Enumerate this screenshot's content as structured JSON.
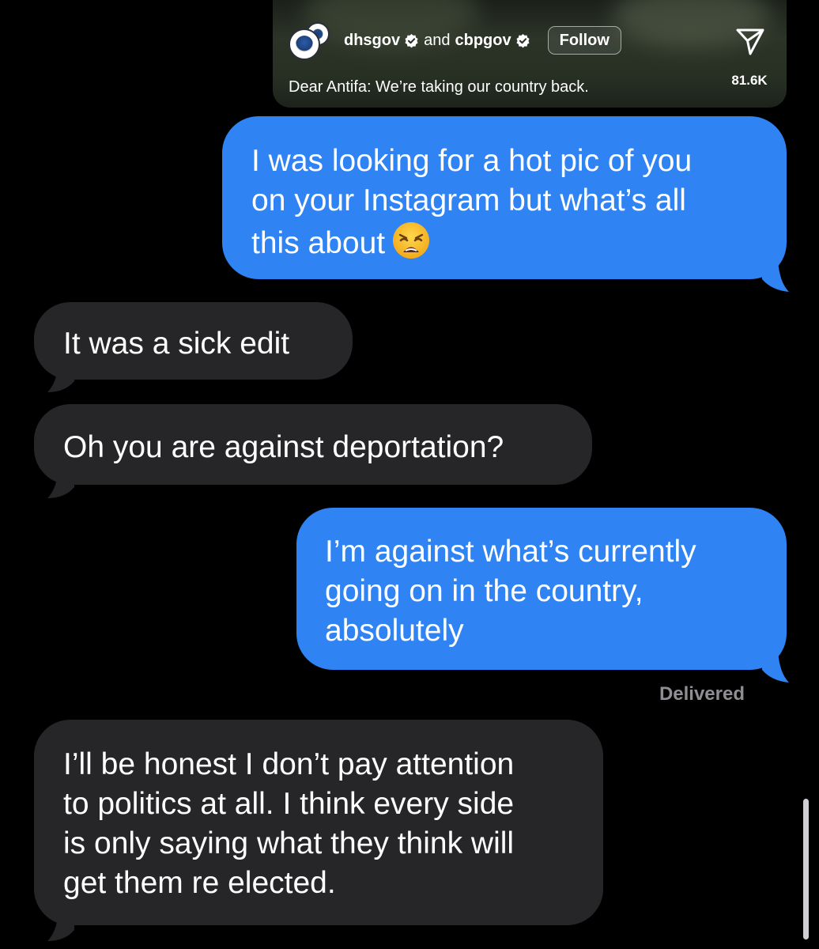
{
  "shared_post": {
    "account_1": "dhsgov",
    "conjunction": "and",
    "account_2": "cbpgov",
    "follow_label": "Follow",
    "caption": "Dear Antifa: We’re taking our country back.",
    "share_count": "81.6K",
    "share_icon": "paper-plane-icon",
    "verified_icon": "verified-badge-icon",
    "avatar_icon": "dhs-seal-icon"
  },
  "messages": [
    {
      "direction": "sent",
      "text": "I was looking for a hot pic of you\non your Instagram but what’s all\nthis about",
      "emoji": "weary-face-emoji"
    },
    {
      "direction": "received",
      "text": "It was a sick edit"
    },
    {
      "direction": "received",
      "text": "Oh you are against deportation?"
    },
    {
      "direction": "sent",
      "text": "I’m against what’s currently\ngoing on in the country,\nabsolutely"
    },
    {
      "direction": "received",
      "text": "I’ll be honest I don’t pay attention\nto politics at all. I think every side\nis only saying what they think will\nget them re elected."
    }
  ],
  "status": {
    "delivered": "Delivered"
  },
  "colors": {
    "sent_bubble": "#2f83f2",
    "received_bubble": "#262628",
    "background": "#000000",
    "status_text": "#8e8e93"
  }
}
